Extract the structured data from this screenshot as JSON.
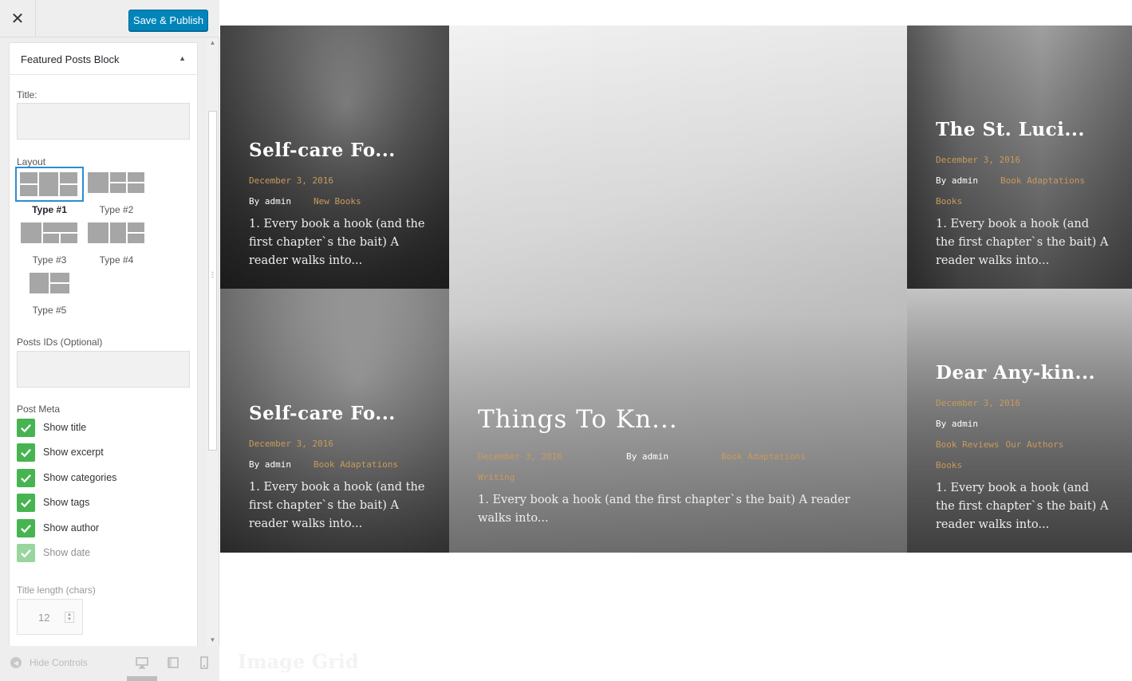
{
  "topbar": {
    "close_glyph": "✕",
    "publish_label": "Save & Publish"
  },
  "panel": {
    "title": "Featured Posts Block",
    "toggle_glyph": "▲",
    "title_label": "Title:",
    "title_value": "",
    "layout_label": "Layout",
    "layouts": [
      {
        "name": "Type #1",
        "selected": true
      },
      {
        "name": "Type #2",
        "selected": false
      },
      {
        "name": "Type #3",
        "selected": false
      },
      {
        "name": "Type #4",
        "selected": false
      },
      {
        "name": "Type #5",
        "selected": false
      }
    ],
    "posts_ids_label": "Posts IDs (Optional)",
    "posts_ids_value": "",
    "post_meta_label": "Post Meta",
    "meta": [
      {
        "label": "Show title",
        "checked": true
      },
      {
        "label": "Show excerpt",
        "checked": true
      },
      {
        "label": "Show categories",
        "checked": true
      },
      {
        "label": "Show tags",
        "checked": true
      },
      {
        "label": "Show author",
        "checked": true
      },
      {
        "label": "Show date",
        "checked": true
      }
    ],
    "title_length_label": "Title length (chars)",
    "title_length_value": "12"
  },
  "footer": {
    "hide_controls_label": "Hide Controls",
    "devices": [
      "desktop-icon",
      "tablet-icon",
      "mobile-icon"
    ]
  },
  "colors": {
    "accent": "#0085ba",
    "checkbox": "#46b450",
    "selected_outline": "#2a8dd4",
    "meta_accent": "#c99a5b"
  },
  "posts": [
    {
      "title": "Self-care Fo...",
      "date": "December 3, 2016",
      "author": "By admin",
      "categories": [
        "New Books"
      ],
      "excerpt": "1. Every book a hook (and the first chapter`s the bait) A reader walks into..."
    },
    {
      "title": "Things To Kn...",
      "date": "December 3, 2016",
      "author": "By admin",
      "categories": [
        "Book Adaptations",
        "Writing"
      ],
      "excerpt": "1. Every book a hook (and the first chapter`s the bait) A reader walks into..."
    },
    {
      "title": "The St. Luci...",
      "date": "December 3, 2016",
      "author": "By admin",
      "categories": [
        "Book Adaptations",
        "Books"
      ],
      "excerpt": "1. Every book a hook (and the first chapter`s the bait) A reader walks into..."
    },
    {
      "title": "Self-care Fo...",
      "date": "December 3, 2016",
      "author": "By admin",
      "categories": [
        "Book Adaptations"
      ],
      "excerpt": "1. Every book a hook (and the first chapter`s the bait) A reader walks into..."
    },
    {
      "title": "Dear Any-kin...",
      "date": "December 3, 2016",
      "author": "By admin",
      "categories": [
        "Book Reviews",
        "Our Authors",
        "Books"
      ],
      "excerpt": "1. Every book a hook (and the first chapter`s the bait) A reader walks into..."
    }
  ],
  "below_section_title": "Image Grid"
}
